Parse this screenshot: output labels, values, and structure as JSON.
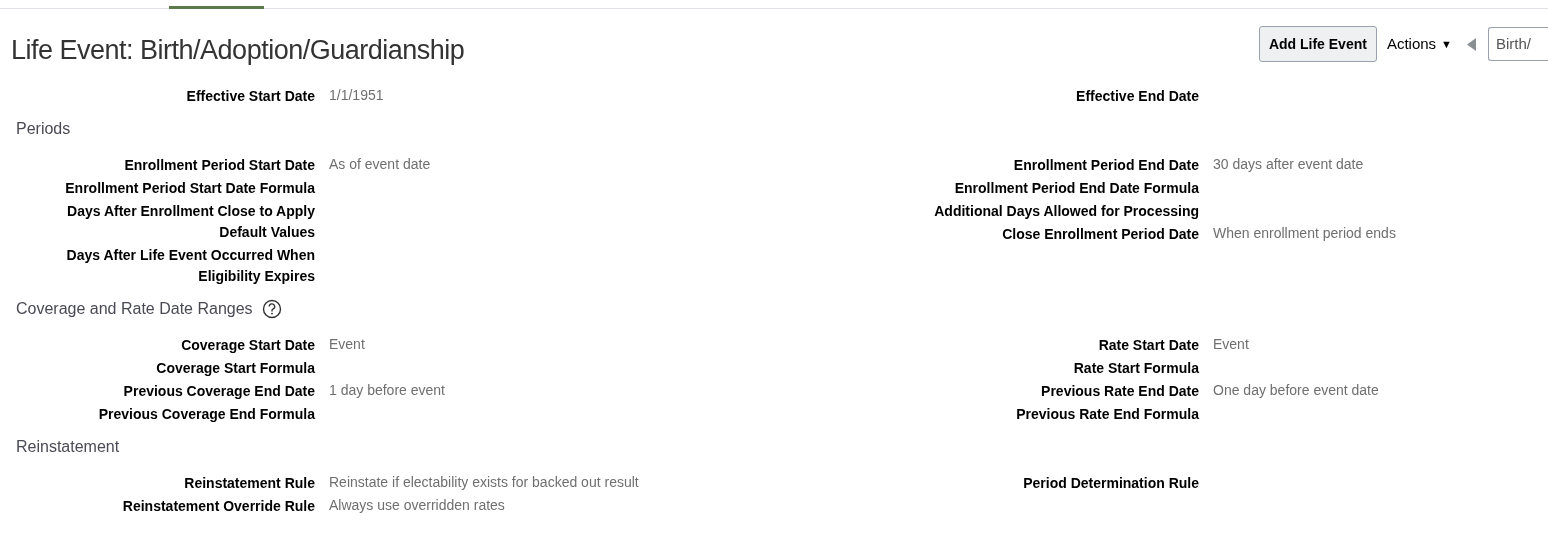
{
  "page_title": "Life Event: Birth/Adoption/Guardianship",
  "toolbar": {
    "add_button": "Add Life Event",
    "actions_menu": "Actions",
    "actions_caret": "▼",
    "record_field_value": "Birth/"
  },
  "header_fields": {
    "left": [
      {
        "label": "Effective Start Date",
        "value": "1/1/1951"
      }
    ],
    "right": [
      {
        "label": "Effective End Date"
      }
    ]
  },
  "sections": [
    {
      "title": "Periods",
      "help": false,
      "left": [
        {
          "label": "Enrollment Period Start Date",
          "value": "As of event date"
        },
        {
          "label": "Enrollment Period Start Date Formula"
        },
        {
          "label": "Days After Enrollment Close to Apply Default Values"
        },
        {
          "label": "Days After Life Event Occurred When Eligibility Expires"
        }
      ],
      "right": [
        {
          "label": "Enrollment Period End Date",
          "value": "30 days after event date"
        },
        {
          "label": "Enrollment Period End Date Formula"
        },
        {
          "label": "Additional Days Allowed for Processing"
        },
        {
          "label": "Close Enrollment Period Date",
          "value": "When enrollment period ends"
        }
      ]
    },
    {
      "title": "Coverage and Rate Date Ranges",
      "help": true,
      "left": [
        {
          "label": "Coverage Start Date",
          "value": "Event"
        },
        {
          "label": "Coverage Start Formula"
        },
        {
          "label": "Previous Coverage End Date",
          "value": "1 day before event"
        },
        {
          "label": "Previous Coverage End Formula"
        }
      ],
      "right": [
        {
          "label": "Rate Start Date",
          "value": "Event"
        },
        {
          "label": "Rate Start Formula"
        },
        {
          "label": "Previous Rate End Date",
          "value": "One day before event date"
        },
        {
          "label": "Previous Rate End Formula"
        }
      ]
    },
    {
      "title": "Reinstatement",
      "help": false,
      "left": [
        {
          "label": "Reinstatement Rule",
          "value": "Reinstate if electability exists for backed out result"
        },
        {
          "label": "Reinstatement Override Rule",
          "value": "Always use overridden rates"
        }
      ],
      "right": [
        {
          "label": "Period Determination Rule"
        }
      ]
    }
  ]
}
